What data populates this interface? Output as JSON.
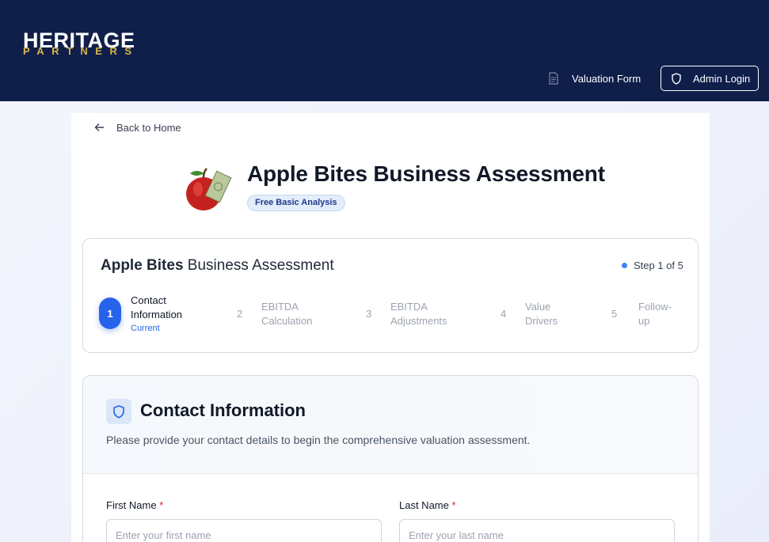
{
  "header": {
    "logo_top": "HERITAGE",
    "logo_bottom": "PARTNERS",
    "nav_form_label": "Valuation Form",
    "admin_login_label": "Admin Login"
  },
  "back_link": "Back to Home",
  "page": {
    "title": "Apple Bites Business Assessment",
    "badge": "Free Basic Analysis"
  },
  "stepper": {
    "title_bold": "Apple Bites",
    "title_rest": " Business Assessment",
    "step_count": "Step 1 of 5",
    "current_tag": "Current",
    "steps": [
      {
        "num": "1",
        "line1": "Contact",
        "line2": "Information"
      },
      {
        "num": "2",
        "line1": "EBITDA",
        "line2": "Calculation"
      },
      {
        "num": "3",
        "line1": "EBITDA",
        "line2": "Adjustments"
      },
      {
        "num": "4",
        "line1": "Value",
        "line2": "Drivers"
      },
      {
        "num": "5",
        "line1": "Follow-",
        "line2": "up"
      }
    ]
  },
  "contact": {
    "title": "Contact Information",
    "description": "Please provide your contact details to begin the comprehensive valuation assessment.",
    "first_name_label": "First Name",
    "first_name_placeholder": "Enter your first name",
    "last_name_label": "Last Name",
    "last_name_placeholder": "Enter your last name",
    "required_mark": "*"
  },
  "colors": {
    "header_bg": "#0f1f4a",
    "accent": "#2563eb",
    "logo_gold": "#d8b44a"
  }
}
